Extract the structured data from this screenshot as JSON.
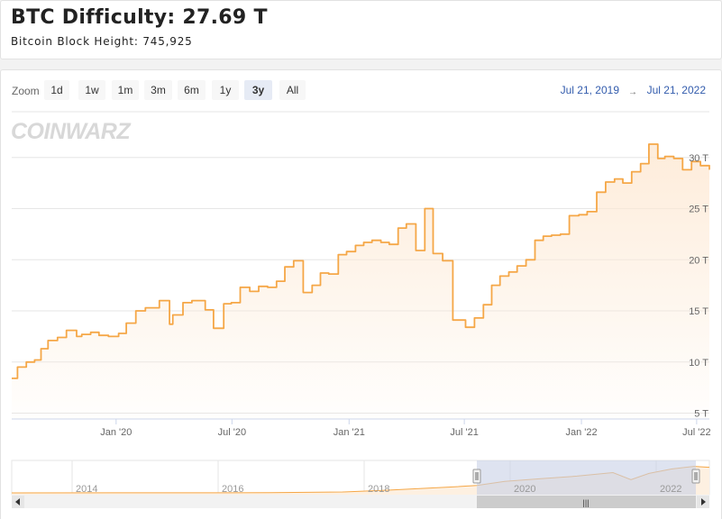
{
  "header": {
    "title": "BTC Difficulty: 27.69 T",
    "subtitle": "Bitcoin Block Height: 745,925"
  },
  "zoom": {
    "label": "Zoom",
    "buttons": [
      "1d",
      "1w",
      "1m",
      "3m",
      "6m",
      "1y",
      "3y",
      "All"
    ],
    "selected": "3y"
  },
  "range": {
    "from": "Jul 21, 2019",
    "arrow": "→",
    "to": "Jul 21, 2022"
  },
  "watermark": "COINWARZ",
  "colors": {
    "line": "#f5a747",
    "area_top": "#fde9d4",
    "accent": "#335cad",
    "navigator_mask": "#c8d0e6"
  },
  "chart_data": {
    "type": "area",
    "title": "",
    "xlabel": "",
    "ylabel": "",
    "x_ticks": [
      "Jan '20",
      "Jul '20",
      "Jan '21",
      "Jul '21",
      "Jan '22",
      "Jul '22"
    ],
    "y_ticks": [
      "5 T",
      "10 T",
      "15 T",
      "20 T",
      "25 T",
      "30 T"
    ],
    "ylim": [
      5,
      32
    ],
    "x_range": [
      "2019-07-21",
      "2022-07-21"
    ],
    "grid": true,
    "legend": "none",
    "series": [
      {
        "unit": "T",
        "x": [
          "2019-07-21",
          "2019-07-30",
          "2019-08-13",
          "2019-08-26",
          "2019-09-05",
          "2019-09-16",
          "2019-10-01",
          "2019-10-15",
          "2019-10-31",
          "2019-11-08",
          "2019-11-22",
          "2019-12-05",
          "2019-12-20",
          "2020-01-05",
          "2020-01-17",
          "2020-02-01",
          "2020-02-16",
          "2020-03-09",
          "2020-03-25",
          "2020-03-30",
          "2020-04-15",
          "2020-04-29",
          "2020-05-20",
          "2020-06-02",
          "2020-06-18",
          "2020-06-30",
          "2020-07-14",
          "2020-07-29",
          "2020-08-12",
          "2020-08-26",
          "2020-09-09",
          "2020-09-22",
          "2020-10-06",
          "2020-10-21",
          "2020-11-04",
          "2020-11-17",
          "2020-11-30",
          "2020-12-15",
          "2020-12-28",
          "2021-01-11",
          "2021-01-24",
          "2021-02-06",
          "2021-02-20",
          "2021-03-05",
          "2021-03-19",
          "2021-04-01",
          "2021-04-16",
          "2021-04-30",
          "2021-05-13",
          "2021-05-28",
          "2021-06-13",
          "2021-07-03",
          "2021-07-17",
          "2021-07-31",
          "2021-08-13",
          "2021-08-26",
          "2021-09-09",
          "2021-09-22",
          "2021-10-06",
          "2021-10-20",
          "2021-11-02",
          "2021-11-15",
          "2021-11-29",
          "2021-12-13",
          "2021-12-28",
          "2022-01-10",
          "2022-01-25",
          "2022-02-08",
          "2022-02-22",
          "2022-03-07",
          "2022-03-21",
          "2022-04-04",
          "2022-04-17",
          "2022-05-01",
          "2022-05-12",
          "2022-05-26",
          "2022-06-09",
          "2022-06-23",
          "2022-07-07",
          "2022-07-21"
        ],
        "values": [
          8.4,
          9.5,
          10.0,
          10.2,
          11.3,
          12.1,
          12.4,
          13.1,
          12.5,
          12.7,
          12.9,
          12.6,
          12.5,
          12.8,
          13.8,
          15.0,
          15.3,
          16.0,
          13.7,
          14.6,
          15.8,
          16.0,
          15.1,
          13.3,
          15.7,
          15.8,
          17.3,
          16.9,
          17.4,
          17.3,
          17.9,
          19.3,
          19.9,
          16.8,
          17.5,
          18.7,
          18.6,
          20.5,
          20.8,
          21.4,
          21.7,
          21.9,
          21.7,
          21.5,
          23.1,
          23.5,
          20.9,
          25.0,
          20.6,
          19.9,
          14.1,
          13.4,
          14.3,
          15.6,
          17.5,
          18.4,
          18.8,
          19.4,
          20.0,
          21.9,
          22.3,
          22.4,
          22.5,
          24.3,
          24.4,
          24.7,
          26.6,
          27.6,
          27.9,
          27.5,
          28.6,
          29.4,
          31.3,
          29.9,
          30.1,
          29.9,
          28.8,
          29.6,
          29.2,
          28.8
        ]
      }
    ]
  },
  "navigator": {
    "year_labels": [
      "2014",
      "2016",
      "2018",
      "2020",
      "2022"
    ],
    "grip": "|||"
  }
}
